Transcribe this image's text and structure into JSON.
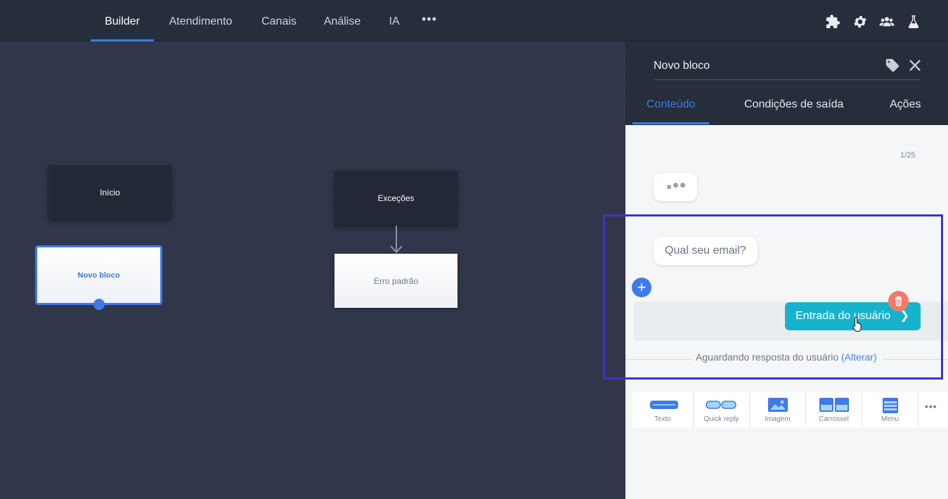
{
  "nav": {
    "items": [
      "Builder",
      "Atendimento",
      "Canais",
      "Análise",
      "IA"
    ],
    "more": "•••",
    "active_color": "#3d7be8",
    "icons": [
      "puzzle-icon",
      "gear-icon",
      "users-icon",
      "flask-icon"
    ]
  },
  "canvas": {
    "blocks": {
      "inicio": "Início",
      "novo_bloco": "Novo bloco",
      "excecoes": "Exceções",
      "erro_padrao": "Erro padrão"
    }
  },
  "panel": {
    "title": "Novo bloco",
    "tabs": [
      "Conteúdo",
      "Condições de saída",
      "Ações"
    ],
    "counter": "1/25",
    "message": "Qual seu email?",
    "add_label": "+",
    "input_button": "Entrada do usuário",
    "input_chevron": "❯",
    "awaiting_text": "Aguardando resposta do usuário",
    "awaiting_link": "(Alterar)",
    "tools": [
      "Texto",
      "Quick reply",
      "Imagem",
      "Carrossel",
      "Menu"
    ],
    "tools_more": "•••"
  },
  "colors": {
    "accent": "#3d7be8",
    "input_button": "#17b3cc",
    "delete": "#f37a6a",
    "highlight": "#3a35c7"
  }
}
